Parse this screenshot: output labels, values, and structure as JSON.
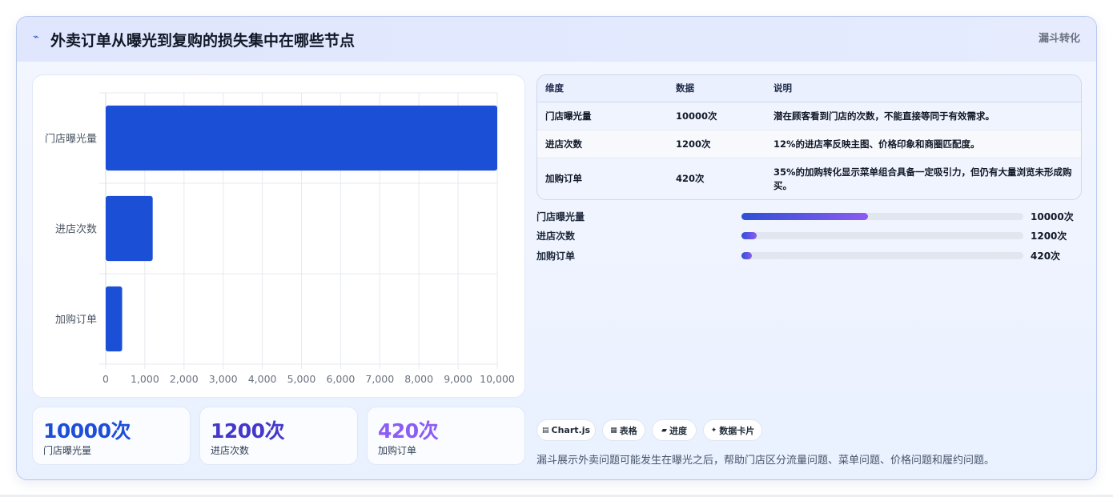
{
  "header": {
    "icon": "trend-line-icon",
    "title": "外卖订单从曝光到复购的损失集中在哪些节点",
    "badge": "漏斗转化"
  },
  "chart_data": {
    "type": "bar",
    "orientation": "horizontal",
    "categories": [
      "门店曝光量",
      "进店次数",
      "加购订单"
    ],
    "values": [
      10000,
      1200,
      420
    ],
    "xlim": [
      0,
      10000
    ],
    "x_ticks": [
      "0",
      "1,000",
      "2,000",
      "3,000",
      "4,000",
      "5,000",
      "6,000",
      "7,000",
      "8,000",
      "9,000",
      "10,000"
    ],
    "bar_color": "#1a4fd6",
    "grid": true
  },
  "stats": [
    {
      "value": "10000次",
      "label": "门店曝光量",
      "color": "#1d4ed8"
    },
    {
      "value": "1200次",
      "label": "进店次数",
      "color": "#4338ca"
    },
    {
      "value": "420次",
      "label": "加购订单",
      "color": "#8b5cf6"
    }
  ],
  "table": {
    "headers": [
      "维度",
      "数据",
      "说明"
    ],
    "rows": [
      {
        "dim": "门店曝光量",
        "data": "10000次",
        "desc": "潜在顾客看到门店的次数，不能直接等同于有效需求。"
      },
      {
        "dim": "进店次数",
        "data": "1200次",
        "desc": "12%的进店率反映主图、价格印象和商圈匹配度。"
      },
      {
        "dim": "加购订单",
        "data": "420次",
        "desc": "35%的加购转化显示菜单组合具备一定吸引力，但仍有大量浏览未形成购买。"
      }
    ]
  },
  "progress": [
    {
      "label": "门店曝光量",
      "value": "10000次",
      "fraction": 0.45
    },
    {
      "label": "进店次数",
      "value": "1200次",
      "fraction": 0.054
    },
    {
      "label": "加购订单",
      "value": "420次",
      "fraction": 0.036
    }
  ],
  "pills": [
    {
      "icon": "chart-icon",
      "glyph": "▤",
      "label": "Chart.js"
    },
    {
      "icon": "table-icon",
      "glyph": "▦",
      "label": "表格"
    },
    {
      "icon": "progress-icon",
      "glyph": "▰",
      "label": "进度"
    },
    {
      "icon": "sparkle-icon",
      "glyph": "✦",
      "label": "数据卡片"
    }
  ],
  "footer": {
    "note": "漏斗展示外卖问题可能发生在曝光之后，帮助门店区分流量问题、菜单问题、价格问题和履约问题。"
  }
}
